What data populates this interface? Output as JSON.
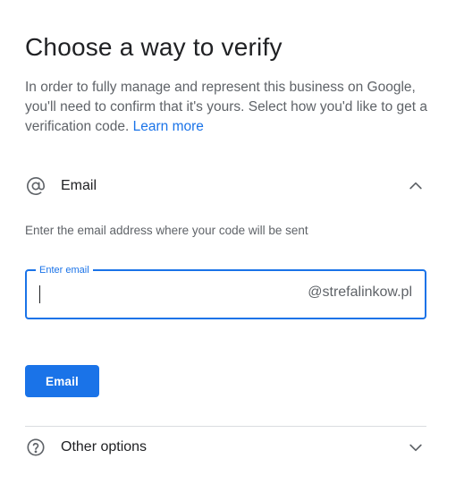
{
  "page": {
    "title": "Choose a way to verify",
    "intro_text": "In order to fully manage and represent this business on Google, you'll need to confirm that it's yours. Select how you'd like to get a verification code.",
    "learn_more_link": "Learn more"
  },
  "email_section": {
    "icon": "at-sign-icon",
    "label": "Email",
    "expanded": true,
    "chevron_icon": "chevron-up-icon",
    "hint": "Enter the email address where your code will be sent",
    "field_label": "Enter email",
    "field_value": "",
    "domain_suffix": "@strefalinkow.pl",
    "submit_label": "Email"
  },
  "other_section": {
    "icon": "help-circle-icon",
    "label": "Other options",
    "expanded": false,
    "chevron_icon": "chevron-down-icon"
  },
  "colors": {
    "accent": "#1a73e8",
    "text_primary": "#202124",
    "text_secondary": "#5f6368",
    "divider": "#dadce0"
  }
}
